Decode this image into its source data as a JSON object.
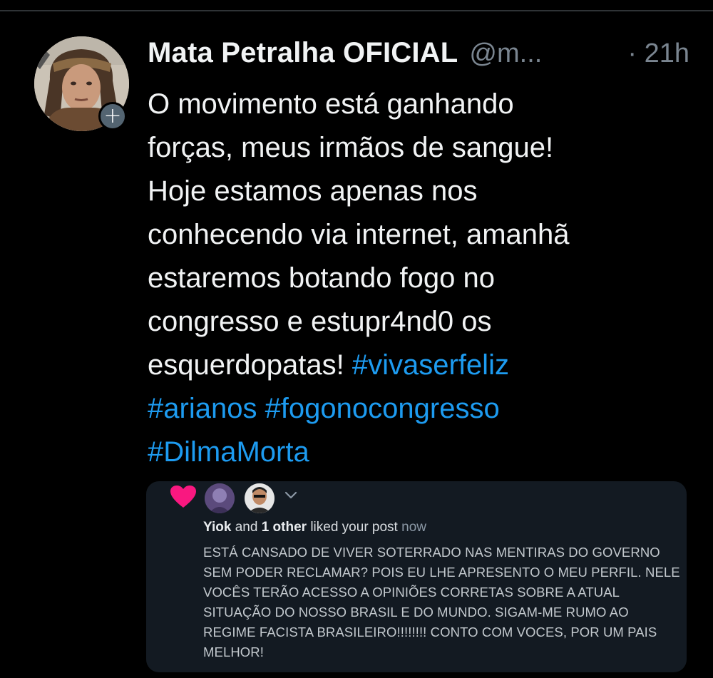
{
  "tweet": {
    "display_name": "Mata Petralha OFICIAL",
    "handle": "@m...",
    "timestamp": "· 21h",
    "text_lines": [
      "O movimento está ganhando",
      "forças, meus irmãos de sangue!",
      "Hoje estamos apenas nos",
      "conhecendo via internet, amanhã",
      "estaremos botando fogo no",
      "congresso e estupr4nd0 os"
    ],
    "line7_text": "esquerdopatas! ",
    "hashtags": [
      "#vivaserfeliz",
      "#arianos",
      "#fogonocongresso",
      "#DilmaMorta"
    ],
    "follow_icon": "plus-icon"
  },
  "embedded": {
    "user1": "Yiok",
    "and_text": "and",
    "other_text": "1 other",
    "liked_text": "liked your post",
    "time_text": "now",
    "body_lines": [
      "ESTÁ CANSADO DE VIVER SOTERRADO NAS MENTIRAS DO GOVERNO",
      "SEM PODER RECLAMAR? POIS EU LHE APRESENTO O MEU PERFIL. NELE",
      "VOCÊS TERÃO ACESSO A OPINIÕES CORRETAS SOBRE A ATUAL",
      "SITUAÇÃO DO NOSSO BRASIL E DO MUNDO. SIGAM-ME RUMO AO",
      "REGIME FACISTA BRASILEIRO!!!!!!!! CONTO COM VOCES, POR UM PAIS",
      "MELHOR!"
    ],
    "icons": [
      "heart-icon",
      "chevron-down-icon"
    ]
  },
  "colors": {
    "background": "#000000",
    "hashtag": "#1d9bf0",
    "muted": "#7a8590",
    "heart": "#f91880",
    "embedded_bg": "#131a22"
  }
}
